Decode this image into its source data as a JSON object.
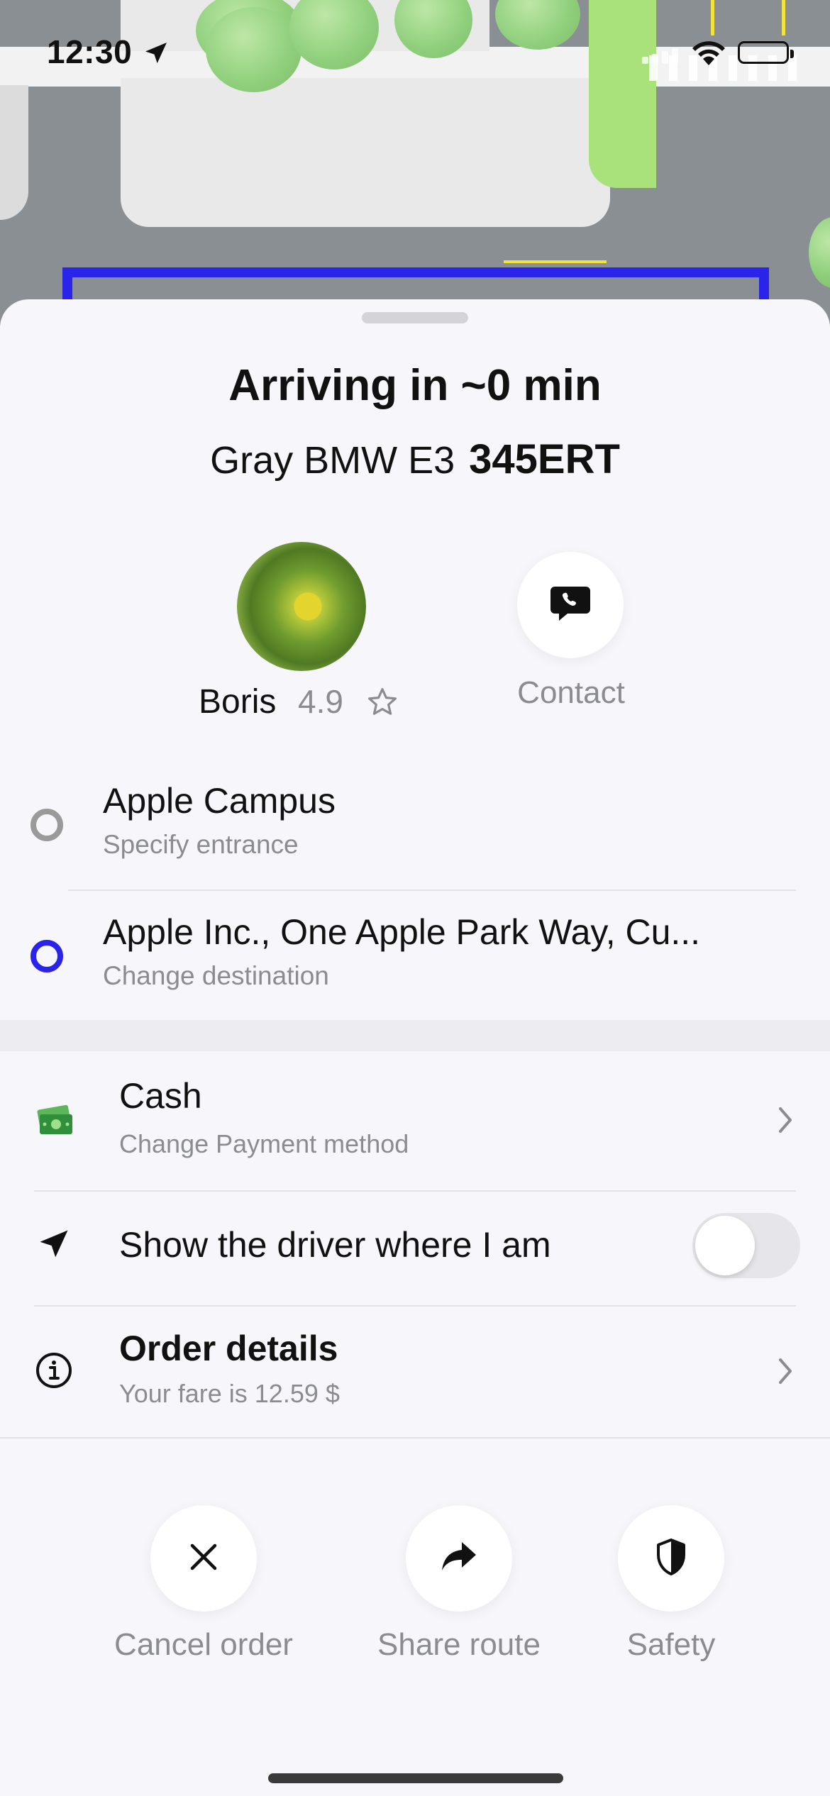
{
  "status_bar": {
    "time": "12:30",
    "location_icon": "location-arrow-icon",
    "signal_icon": "cellular-signal-icon",
    "wifi_icon": "wifi-icon",
    "battery_icon": "battery-icon"
  },
  "map": {
    "route_color": "#2a24ea"
  },
  "trip": {
    "title": "Arriving in ~0 min",
    "car_model": "Gray BMW E3",
    "plate": "345ERT"
  },
  "driver": {
    "name": "Boris",
    "rating": "4.9",
    "rating_icon": "star-outline-icon",
    "contact_label": "Contact",
    "contact_icon": "phone-message-icon"
  },
  "route": {
    "pickup": {
      "title": "Apple Campus",
      "subtitle": "Specify entrance"
    },
    "destination": {
      "title": "Apple Inc., One Apple Park Way, Cu...",
      "subtitle": "Change destination"
    }
  },
  "payment": {
    "title": "Cash",
    "subtitle": "Change Payment method",
    "icon": "cash-icon"
  },
  "share_location": {
    "label": "Show the driver where I am",
    "enabled": false
  },
  "order_details": {
    "title": "Order details",
    "subtitle": "Your fare is 12.59 $",
    "icon": "info-icon"
  },
  "actions": {
    "cancel": "Cancel order",
    "share": "Share route",
    "safety": "Safety"
  },
  "colors": {
    "accent": "#2a24ea",
    "muted_text": "#8b8b92",
    "sheet_background": "#f7f7fb"
  }
}
